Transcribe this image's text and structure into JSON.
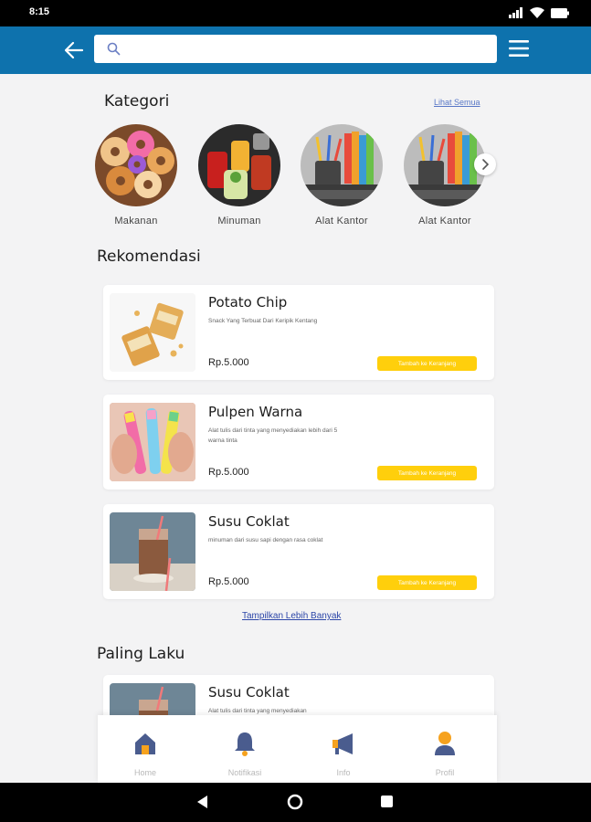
{
  "status_bar": {
    "time": "8:15"
  },
  "header": {
    "search": {
      "value": "",
      "placeholder": ""
    }
  },
  "categories": {
    "title": "Kategori",
    "see_all": "Lihat Semua",
    "items": [
      {
        "label": "Makanan"
      },
      {
        "label": "Minuman"
      },
      {
        "label": "Alat Kantor"
      },
      {
        "label": "Alat Kantor"
      }
    ]
  },
  "recommendations": {
    "title": "Rekomendasi",
    "items": [
      {
        "name": "Potato Chip",
        "description": "Snack Yang Terbuat Dari Keripik Kentang",
        "price": "Rp.5.000",
        "button": "Tambah ke Keranjang"
      },
      {
        "name": "Pulpen Warna",
        "description": "Alat tulis dari tinta yang menyediakan lebih dari 5 warna tinta",
        "price": "Rp.5.000",
        "button": "Tambah ke Keranjang"
      },
      {
        "name": "Susu Coklat",
        "description": "minuman dari susu sapi dengan rasa coklat",
        "price": "Rp.5.000",
        "button": "Tambah ke Keranjang"
      }
    ],
    "more_link": "Tampilkan Lebih Banyak"
  },
  "best_selling": {
    "title": "Paling Laku",
    "items": [
      {
        "name": "Susu Coklat",
        "description": "Alat tulis dari tinta yang menyediakan"
      }
    ]
  },
  "bottom_nav": {
    "items": [
      {
        "label": "Home",
        "icon": "home-icon"
      },
      {
        "label": "Notifikasi",
        "icon": "bell-icon"
      },
      {
        "label": "Info",
        "icon": "megaphone-icon"
      },
      {
        "label": "Profil",
        "icon": "profile-icon"
      }
    ]
  },
  "colors": {
    "header_blue": "#0e72ad",
    "button_yellow": "#ffcf0c",
    "nav_icon_blue": "#4a5c8e",
    "accent_orange": "#f6a21e"
  }
}
